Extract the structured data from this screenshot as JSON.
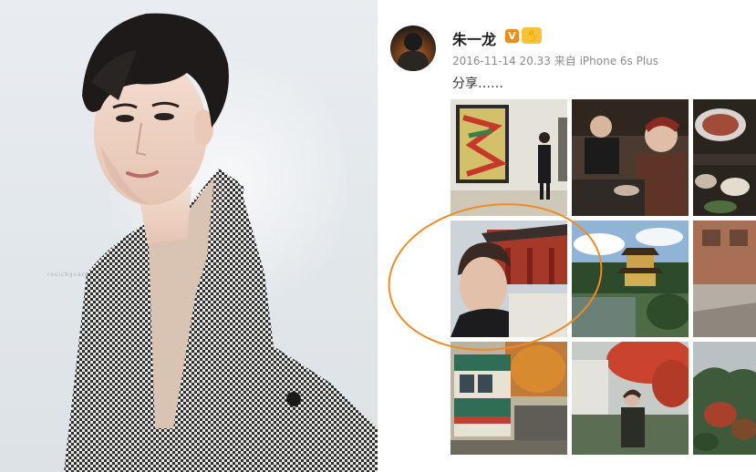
{
  "left_image": {
    "watermark": "rosicbgcare"
  },
  "post": {
    "username": "朱一龙",
    "verified_badge": "V",
    "timestamp": "2016-11-14 20.33",
    "source_prefix": "来自",
    "device": "iPhone 6s Plus",
    "caption": "分享……",
    "photos": [
      {
        "name": "museum-painting"
      },
      {
        "name": "restaurant-selfie"
      },
      {
        "name": "food-table"
      },
      {
        "name": "shrine-selfie"
      },
      {
        "name": "golden-pavilion"
      },
      {
        "name": "brick-building-street"
      },
      {
        "name": "green-tram"
      },
      {
        "name": "autumn-park-walk"
      },
      {
        "name": "forest-autumn-view"
      }
    ],
    "highlight_color": "#f08a24"
  }
}
